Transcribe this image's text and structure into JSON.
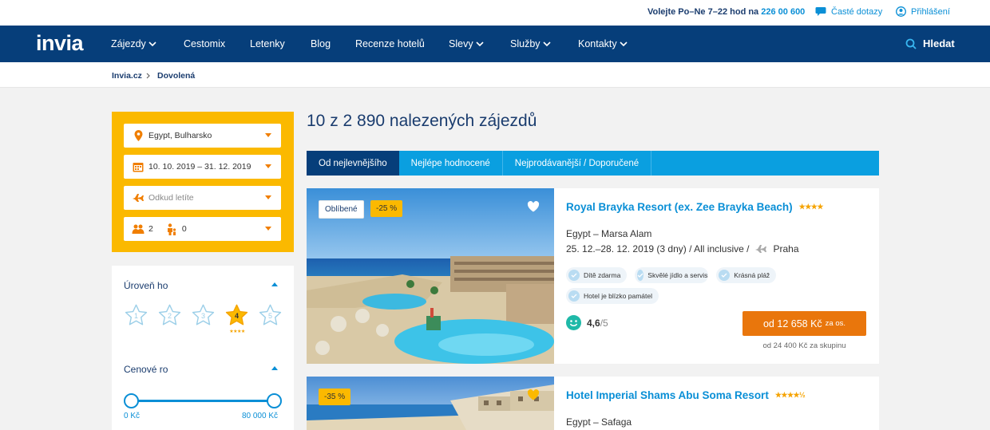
{
  "topbar": {
    "call_label": "Volejte Po–Ne 7–22 hod na",
    "phone": "226 00 600",
    "faq": "Časté dotazy",
    "login": "Přihlášení"
  },
  "nav": {
    "logo": "invia",
    "items": [
      "Zájezdy",
      "Cestomix",
      "Letenky",
      "Blog",
      "Recenze hotelů",
      "Slevy",
      "Služby",
      "Kontakty"
    ],
    "search": "Hledat"
  },
  "breadcrumb": [
    "Invia.cz",
    "Dovolená"
  ],
  "filters": {
    "destination": "Egypt, Bulharsko",
    "dates": "10. 10. 2019 – 31. 12. 2019",
    "departure_placeholder": "Odkud letíte",
    "adults": "2",
    "children": "0"
  },
  "sidebar": {
    "level_title": "Úroveň ho",
    "star_levels": [
      "1",
      "2",
      "3",
      "4",
      "5"
    ],
    "selected_stars": 4,
    "price_title": "Cenové ro",
    "price_min": "0 Kč",
    "price_max": "80 000 Kč"
  },
  "results": {
    "title": "10 z 2 890 nalezených zájezdů",
    "sort_tabs": [
      "Od nejlevnějšího",
      "Nejlépe hodnocené",
      "Nejprodávanější / Doporučené"
    ],
    "hotels": [
      {
        "badge_popular": "Oblíbené",
        "discount": "-25 %",
        "name": "Royal Brayka Resort (ex. Zee Brayka Beach)",
        "stars": 4,
        "location": "Egypt – Marsa Alam",
        "details": "25. 12.–28. 12. 2019 (3 dny) / All inclusive /",
        "airport": "Praha",
        "tags": [
          "Dítě zdarma",
          "Skvělé jídlo a servis",
          "Krásná pláž",
          "Hotel je blízko památel"
        ],
        "rating": "4,6",
        "rating_max": "/5",
        "price": "od 12 658 Kč",
        "price_per": "za os.",
        "group_price": "od 24 400 Kč za skupinu"
      },
      {
        "discount": "-35 %",
        "name": "Hotel Imperial Shams Abu Soma Resort",
        "stars": 4.5,
        "location": "Egypt – Safaga"
      }
    ]
  },
  "colors": {
    "navy": "#063e7a",
    "blue": "#0a9fe0",
    "yellow": "#fbb900",
    "orange": "#e9760c"
  }
}
